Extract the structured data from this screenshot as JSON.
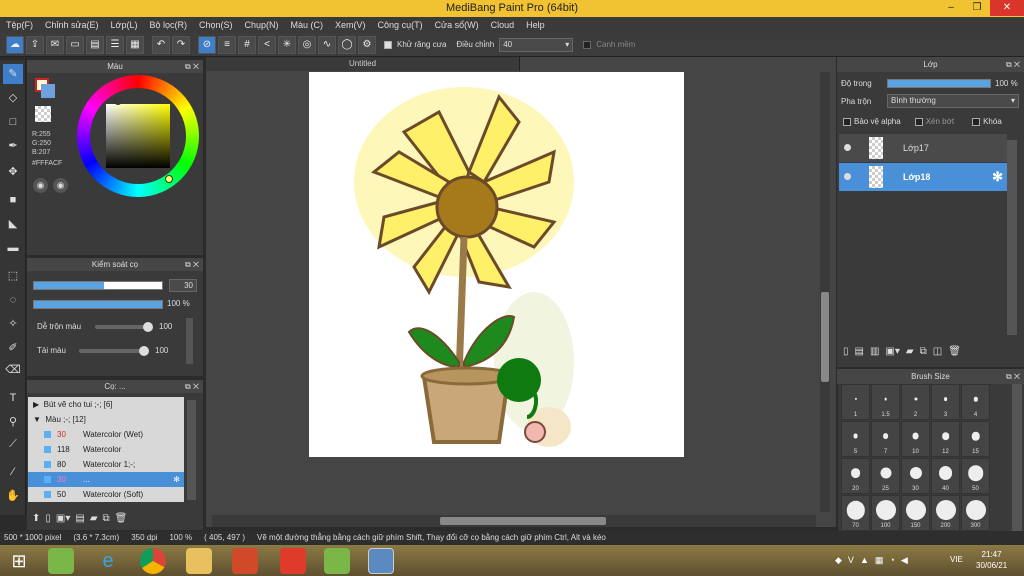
{
  "app_title": "MediBang Paint Pro (64bit)",
  "window_controls": [
    "–",
    "❐",
    "✕"
  ],
  "menu": [
    "Tệp(F)",
    "Chỉnh sửa(E)",
    "Lớp(L)",
    "Bộ lọc(R)",
    "Chọn(S)",
    "Chụp(N)",
    "Màu (C)",
    "Xem(V)",
    "Công cụ(T)",
    "Cửa sổ(W)",
    "Cloud",
    "Help"
  ],
  "toolbar": {
    "antialias_label": "Khử răng cưa",
    "adjust_label": "Điều chỉnh",
    "adjust_value": "40",
    "canh_mem_label": "Canh mềm"
  },
  "color_panel": {
    "title": "Màu",
    "r": "R:255",
    "g": "G:250",
    "b": "B:207",
    "hex": "#FFFACF",
    "fg_color": "#FFFACF",
    "accent": "#3f7fc9"
  },
  "brush_control": {
    "title": "Kiểm soát cọ",
    "size_value": "30",
    "opacity_value": "100 %",
    "size_fraction": 0.55,
    "opacity_fraction": 1.0,
    "blend_label": "Dễ trộn màu",
    "blend_value": "100",
    "color_amount_label": "Tải màu",
    "color_amount_value": "100"
  },
  "brush_list": {
    "title": "Cọ: ...",
    "groups": [
      {
        "label": "Bút vẽ cho tui ;-; [6]",
        "expanded": false
      },
      {
        "label": "Màu ;-; [12]",
        "expanded": true
      }
    ],
    "items": [
      {
        "size": "30",
        "name": "Watercolor (Wet)",
        "selected": false
      },
      {
        "size": "118",
        "name": "Watercolor",
        "selected": false
      },
      {
        "size": "80",
        "name": "Watercolor 1;-;",
        "selected": false
      },
      {
        "size": "30",
        "name": "...",
        "selected": true
      },
      {
        "size": "50",
        "name": "Watercolor (Soft)",
        "selected": false
      }
    ]
  },
  "canvas": {
    "tab": "Untitled"
  },
  "layer_panel": {
    "title": "Lớp",
    "opacity_label": "Độ trong",
    "opacity_value": "100 %",
    "blend_label": "Pha trộn",
    "blend_value": "Bình thường",
    "protect_alpha": "Bảo vệ alpha",
    "clipping": "Xén bớt",
    "lock": "Khóa",
    "layers": [
      {
        "name": "Lớp17",
        "selected": false
      },
      {
        "name": "Lớp18",
        "selected": true
      }
    ]
  },
  "brush_size": {
    "title": "Brush Size",
    "sizes": [
      "1",
      "1.5",
      "2",
      "3",
      "4",
      "5",
      "7",
      "10",
      "12",
      "15",
      "20",
      "25",
      "30",
      "40",
      "50",
      "70",
      "100",
      "150",
      "200",
      "300"
    ]
  },
  "status": {
    "dims": "500 * 1000 pixel",
    "cm": "(3.6 * 7.3cm)",
    "dpi": "350 dpi",
    "zoom": "100 %",
    "coords": "( 405, 497 )",
    "hint": "Vẽ một đường thẳng bằng cách giữ phím Shift, Thay đổi cỡ cọ bằng cách giữ phím Ctrl, Alt và kéo"
  },
  "taskbar": {
    "lang": "VIE",
    "time": "21:47",
    "date": "30/06/21"
  }
}
